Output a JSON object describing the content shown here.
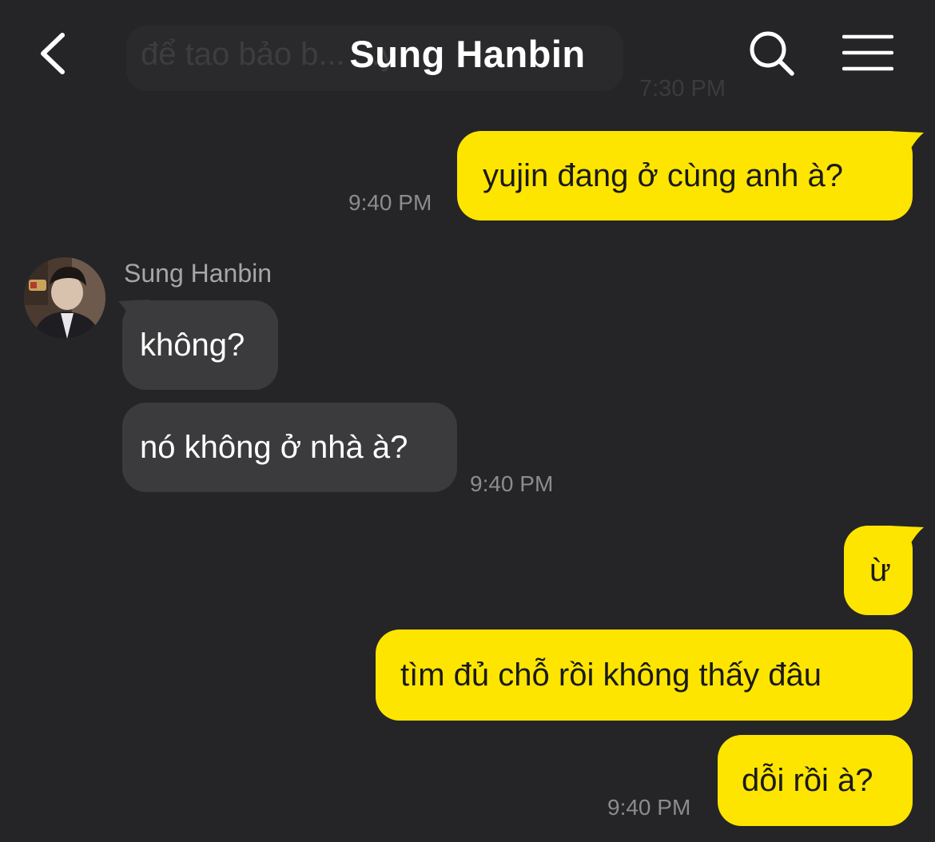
{
  "header": {
    "title": "Sung Hanbin",
    "back_icon": "chevron-left-icon",
    "search_icon": "search-icon",
    "menu_icon": "hamburger-menu-icon"
  },
  "ghost": {
    "text": "để tao bảo b... ...y",
    "time": "7:30 PM"
  },
  "contact": {
    "name": "Sung Hanbin"
  },
  "messages": [
    {
      "direction": "out",
      "text": "yujin đang ở cùng anh à?",
      "time": "9:40 PM"
    },
    {
      "direction": "in",
      "text": "không?",
      "time": ""
    },
    {
      "direction": "in",
      "text": "nó không ở nhà à?",
      "time": "9:40 PM"
    },
    {
      "direction": "out",
      "text": "ừ",
      "time": ""
    },
    {
      "direction": "out",
      "text": "tìm đủ chỗ rồi không thấy đâu",
      "time": ""
    },
    {
      "direction": "out",
      "text": "dỗi rồi à?",
      "time": "9:40 PM"
    }
  ],
  "colors": {
    "background": "#252527",
    "outgoing_bubble": "#fee500",
    "incoming_bubble": "#3b3b3d",
    "timestamp": "#8c8c8e"
  }
}
